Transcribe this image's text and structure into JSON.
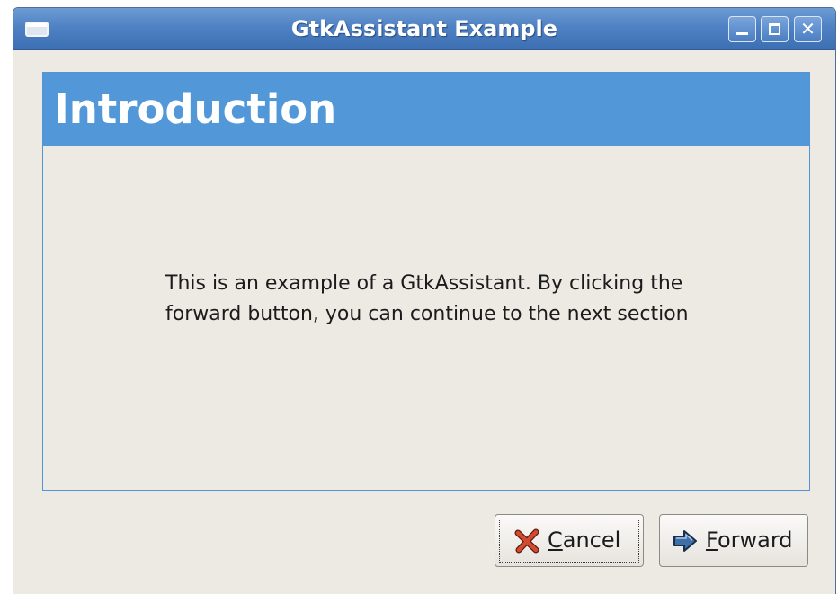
{
  "window": {
    "title": "GtkAssistant Example"
  },
  "page": {
    "title": "Introduction",
    "body_text": "This is an example of a GtkAssistant. By clicking the forward button, you can continue to the next section"
  },
  "buttons": {
    "cancel": {
      "mnemonic": "C",
      "rest": "ancel",
      "icon": "cancel-x-icon"
    },
    "forward": {
      "mnemonic": "F",
      "rest": "orward",
      "icon": "forward-arrow-icon"
    }
  },
  "colors": {
    "titlebar": "#4f82c4",
    "page_header": "#5297d8",
    "window_bg": "#edeae4"
  }
}
